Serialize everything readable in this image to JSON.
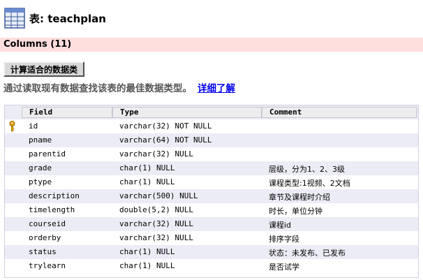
{
  "header": {
    "title": "表: teachplan",
    "icon": "table-grid-icon"
  },
  "columns_bar": {
    "label": "Columns (11)"
  },
  "optimize": {
    "button_label": "计算适合的数据类",
    "description": "通过读取现有数据查找该表的最佳数据类型。",
    "link_label": "详细了解"
  },
  "table": {
    "headers": [
      "Field",
      "Type",
      "Comment"
    ],
    "rows": [
      {
        "field": "id",
        "type": "varchar(32) NOT NULL",
        "comment": "",
        "primary_key": true
      },
      {
        "field": "pname",
        "type": "varchar(64) NOT NULL",
        "comment": ""
      },
      {
        "field": "parentid",
        "type": "varchar(32) NULL",
        "comment": ""
      },
      {
        "field": "grade",
        "type": "char(1) NULL",
        "comment": "层级，分为1、2、3级"
      },
      {
        "field": "ptype",
        "type": "char(1) NULL",
        "comment": "课程类型:1视频、2文档"
      },
      {
        "field": "description",
        "type": "varchar(500) NULL",
        "comment": "章节及课程时介绍"
      },
      {
        "field": "timelength",
        "type": "double(5,2) NULL",
        "comment": "时长，单位分钟"
      },
      {
        "field": "courseid",
        "type": "varchar(32) NULL",
        "comment": "课程id"
      },
      {
        "field": "orderby",
        "type": "varchar(32) NULL",
        "comment": "排序字段"
      },
      {
        "field": "status",
        "type": "char(1) NULL",
        "comment": "状态：未发布、已发布"
      },
      {
        "field": "trylearn",
        "type": "char(1) NULL",
        "comment": "是否试学"
      }
    ]
  },
  "colors": {
    "columns_bar": "#ffdede",
    "row_alt": "#ececf6",
    "link": "#0000ee",
    "key_icon": "#e0a000"
  }
}
